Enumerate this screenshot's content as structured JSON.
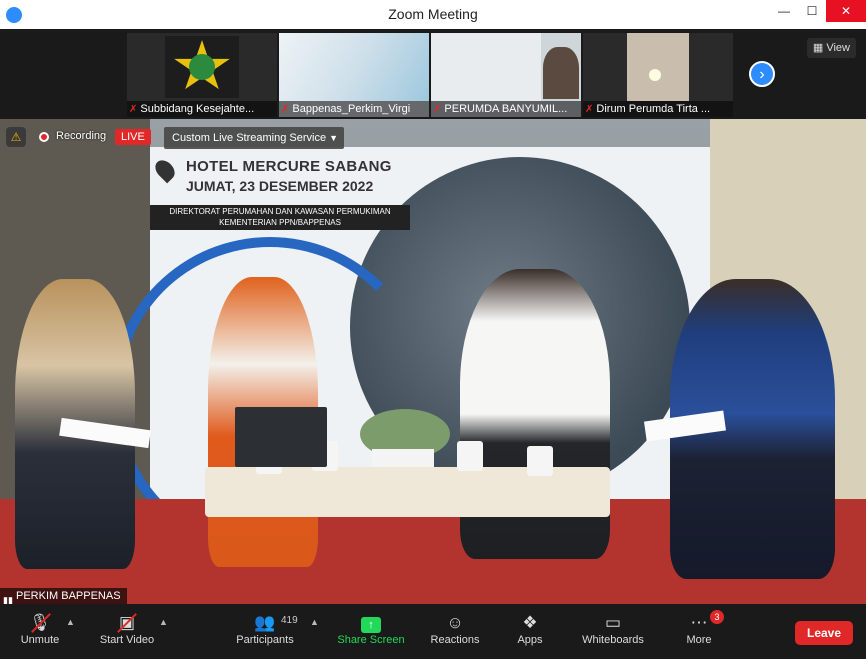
{
  "window": {
    "title": "Zoom Meeting",
    "minimize": "—",
    "maximize": "☐",
    "close": "✕"
  },
  "gallery": {
    "tiles": [
      {
        "name": "Subbidang Kesejahte..."
      },
      {
        "name": "Bappenas_Perkim_Virgi"
      },
      {
        "name": "PERUMDA BANYUMIL..."
      },
      {
        "name": "Dirum Perumda Tirta ..."
      }
    ],
    "view_label": "View"
  },
  "status": {
    "recording_label": "Recording",
    "live_label": "LIVE",
    "stream_service": "Custom Live Streaming Service"
  },
  "video": {
    "venue": "HOTEL MERCURE SABANG",
    "date": "JUMAT, 23 DESEMBER 2022",
    "banner_line1": "DIREKTORAT PERUMAHAN DAN KAWASAN PERMUKIMAN",
    "banner_line2": "KEMENTERIAN PPN/BAPPENAS",
    "speaker": "PERKIM BAPPENAS"
  },
  "toolbar": {
    "unmute": "Unmute",
    "start_video": "Start Video",
    "participants": "Participants",
    "participants_count": "419",
    "share_screen": "Share Screen",
    "reactions": "Reactions",
    "apps": "Apps",
    "whiteboards": "Whiteboards",
    "more": "More",
    "more_badge": "3",
    "leave": "Leave"
  },
  "colors": {
    "accent_blue": "#2d8cff",
    "live_red": "#e02828",
    "share_green": "#23d959"
  }
}
